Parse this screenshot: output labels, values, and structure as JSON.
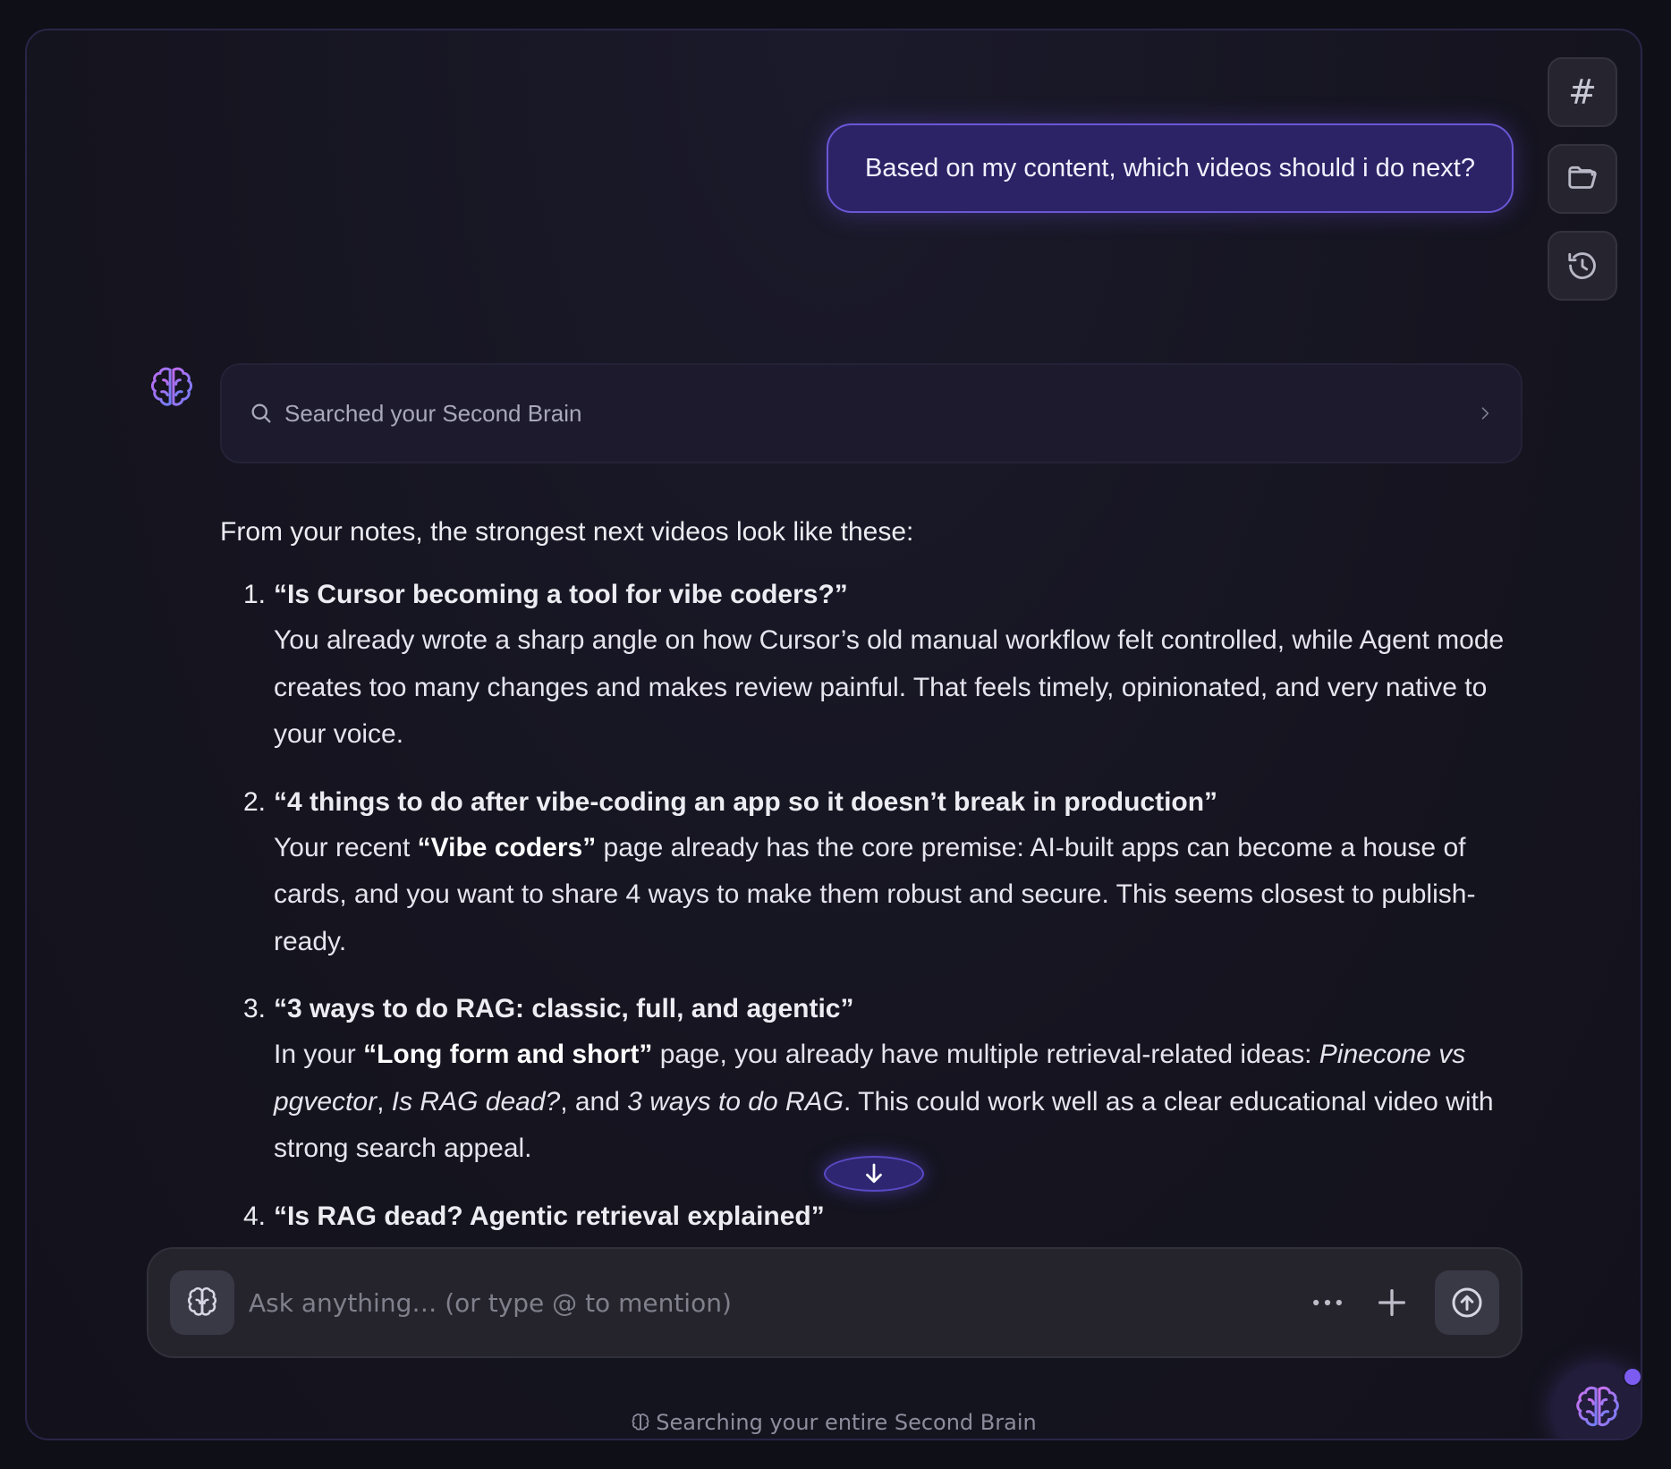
{
  "toolbar": {
    "tags_icon": "hash-icon",
    "folder_icon": "folder-icon",
    "history_icon": "history-icon"
  },
  "user_message": "Based on my content, which videos should i do next?",
  "search_card": {
    "label": "Searched your Second Brain"
  },
  "answer": {
    "intro": "From your notes, the strongest next videos look like these:",
    "items": [
      {
        "num": "1.",
        "title": "“Is Cursor becoming a tool for vibe coders?”",
        "body": "You already wrote a sharp angle on how Cursor’s old manual workflow felt controlled, while Agent mode creates too many changes and makes review painful. That feels timely, opinionated, and very native to your voice."
      },
      {
        "num": "2.",
        "title": "“4 things to do after vibe-coding an app so it doesn’t break in production”",
        "body_pre": "Your recent ",
        "body_bold": "“Vibe coders”",
        "body_post": " page already has the core premise: AI-built apps can become a house of cards, and you want to share 4 ways to make them robust and secure. This seems closest to publish-ready."
      },
      {
        "num": "3.",
        "title": "“3 ways to do RAG: classic, full, and agentic”",
        "body_pre": "In your ",
        "body_bold": "“Long form and short”",
        "body_mid": " page, you already have multiple retrieval-related ideas: ",
        "body_i1": "Pinecone vs pgvector",
        "body_sep1": ", ",
        "body_i2": "Is RAG dead?",
        "body_sep2": ", and ",
        "body_i3": "3 ways to do RAG",
        "body_post": ". This could work well as a clear educational video with strong search appeal."
      },
      {
        "num": "4.",
        "title": "“Is RAG dead? Agentic retrieval explained”"
      }
    ]
  },
  "composer": {
    "placeholder": "Ask anything… (or type @ to mention)",
    "value": ""
  },
  "footer_note": "Searching your entire Second Brain",
  "colors": {
    "accent": "#6a57d6",
    "bubble_bg": "#2c2366",
    "background": "#15141f"
  }
}
